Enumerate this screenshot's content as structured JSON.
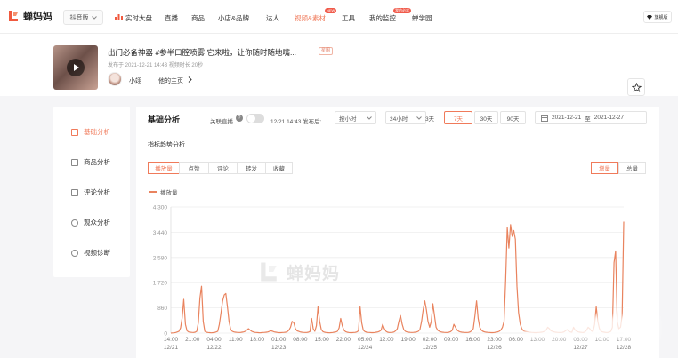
{
  "topnav": {
    "logo_text": "蝉妈妈",
    "platform": "抖音版",
    "items": [
      {
        "label": "实时大盘",
        "badge": ""
      },
      {
        "label": "直播",
        "badge": ""
      },
      {
        "label": "商品",
        "badge": ""
      },
      {
        "label": "小店&品牌",
        "badge": ""
      },
      {
        "label": "达人",
        "badge": ""
      },
      {
        "label": "视频&素材",
        "badge": "NEW"
      },
      {
        "label": "工具",
        "badge": ""
      },
      {
        "label": "我的监控",
        "badge": "我的必求"
      },
      {
        "label": "蝉学园",
        "badge": ""
      }
    ],
    "right_label": "旗舰版"
  },
  "video": {
    "title": "出门必备神器 #参半口腔喷雾 它来啦，让你随时随地嘴...",
    "tag": "星图",
    "meta": "发布于 2021-12-21 14:43  视频时长 20秒",
    "author": "小翊",
    "homepage": "他的主页",
    "fav_icon": "star-icon"
  },
  "sidebar": {
    "items": [
      {
        "label": "基础分析",
        "icon": "chart-icon"
      },
      {
        "label": "商品分析",
        "icon": "cart-icon"
      },
      {
        "label": "评论分析",
        "icon": "comment-icon"
      },
      {
        "label": "观众分析",
        "icon": "user-icon"
      },
      {
        "label": "视频诊断",
        "icon": "diagnose-icon"
      }
    ],
    "active": 0
  },
  "panel": {
    "title": "基础分析",
    "live_label": "关联直播",
    "help": "?",
    "publish_label": "12/21 14:43  发布后:",
    "interval": "按小时",
    "duration": "24小时",
    "ranges": [
      "3天",
      "7天",
      "30天",
      "90天"
    ],
    "range_active": 1,
    "date_start": "2021-12-21",
    "date_sep": "至",
    "date_end": "2021-12-27",
    "subtitle": "指标趋势分析",
    "metric_tabs": [
      "播放量",
      "点赞",
      "评论",
      "转发",
      "收藏"
    ],
    "metric_active": 0,
    "modes": [
      "增量",
      "总量"
    ],
    "mode_active": 0,
    "legend": "播放量",
    "watermark": "蝉妈妈"
  },
  "chart_data": {
    "type": "line",
    "series": [
      {
        "name": "播放量",
        "color": "#e9835e"
      }
    ],
    "y_ticks": [
      "0",
      "860",
      "1,720",
      "2,580",
      "3,440",
      "4,300"
    ],
    "ylim": [
      0,
      4300
    ],
    "x_ticks": [
      "14:00",
      "21:00",
      "04:00",
      "11:00",
      "18:00",
      "01:00",
      "08:00",
      "15:00",
      "22:00",
      "05:00",
      "12:00",
      "19:00",
      "02:00",
      "09:00",
      "16:00",
      "23:00",
      "06:00",
      "13:00",
      "20:00",
      "03:00",
      "10:00",
      "17:00"
    ],
    "x_dates": [
      {
        "label": "12/21",
        "tick": 0
      },
      {
        "label": "12/22",
        "tick": 2
      },
      {
        "label": "12/23",
        "tick": 5
      },
      {
        "label": "12/24",
        "tick": 9
      },
      {
        "label": "12/25",
        "tick": 12
      },
      {
        "label": "12/26",
        "tick": 15
      },
      {
        "label": "12/27",
        "tick": 19
      },
      {
        "label": "12/28",
        "tick": 21
      }
    ],
    "values": [
      0,
      5,
      10,
      20,
      40,
      60,
      180,
      520,
      1150,
      300,
      80,
      40,
      30,
      25,
      20,
      30,
      60,
      350,
      1200,
      1600,
      400,
      60,
      30,
      20,
      15,
      10,
      15,
      20,
      40,
      60,
      300,
      700,
      1100,
      1300,
      1350,
      900,
      400,
      120,
      60,
      40,
      30,
      25,
      20,
      20,
      30,
      40,
      60,
      100,
      150,
      100,
      60,
      40,
      25,
      20,
      15,
      10,
      15,
      20,
      25,
      30,
      40,
      60,
      80,
      60,
      40,
      30,
      20,
      15,
      15,
      20,
      25,
      30,
      50,
      100,
      200,
      400,
      350,
      150,
      80,
      60,
      40,
      30,
      25,
      20,
      20,
      30,
      50,
      500,
      150,
      60,
      250,
      900,
      400,
      120,
      50,
      30,
      20,
      15,
      10,
      15,
      20,
      30,
      40,
      60,
      180,
      500,
      250,
      100,
      50,
      30,
      20,
      15,
      15,
      20,
      25,
      40,
      80,
      900,
      350,
      100,
      50,
      30,
      25,
      20,
      15,
      15,
      20,
      30,
      40,
      60,
      100,
      300,
      150,
      60,
      30,
      20,
      20,
      25,
      40,
      80,
      150,
      400,
      600,
      300,
      120,
      60,
      40,
      30,
      25,
      20,
      25,
      30,
      40,
      60,
      120,
      400,
      800,
      1100,
      800,
      400,
      200,
      400,
      1000,
      600,
      200,
      100,
      60,
      40,
      30,
      25,
      20,
      20,
      30,
      50,
      100,
      300,
      200,
      100,
      60,
      40,
      30,
      25,
      20,
      20,
      25,
      40,
      80,
      150,
      600,
      1100,
      500,
      200,
      100,
      60,
      40,
      30,
      25,
      20,
      15,
      15,
      20,
      30,
      40,
      60,
      100,
      200,
      400,
      1800,
      3600,
      2900,
      3700,
      3300,
      3500,
      3200,
      1600,
      700,
      300,
      150,
      80,
      60,
      50,
      40,
      30,
      25,
      20,
      15,
      15,
      20,
      25,
      30,
      40,
      60,
      100,
      200,
      150,
      80,
      60,
      40,
      30,
      25,
      20,
      20,
      25,
      40,
      80,
      120,
      60,
      40,
      30,
      200,
      100,
      60,
      40,
      30,
      25,
      20,
      40,
      100,
      200,
      150,
      80,
      50,
      300,
      900,
      400,
      150,
      60,
      40,
      30,
      20,
      20,
      30,
      60,
      200,
      2400,
      2800,
      400,
      150,
      200,
      600,
      3800
    ]
  }
}
